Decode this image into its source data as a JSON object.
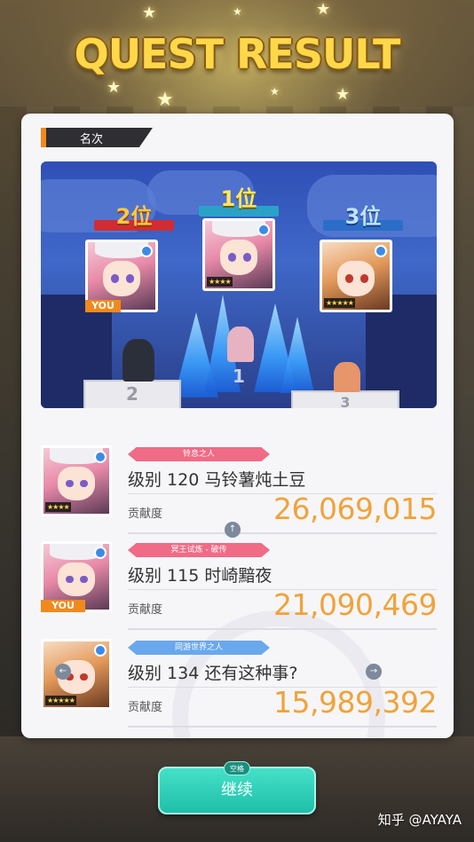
{
  "title": "QUEST RESULT",
  "section_label": "名次",
  "podium": [
    {
      "rank_label": "2位",
      "badge": "YOU",
      "stars": "★★★★★"
    },
    {
      "rank_label": "1位",
      "badge": "",
      "stars": "★★★★"
    },
    {
      "rank_label": "3位",
      "badge": "",
      "stars": "★★★★★"
    }
  ],
  "podium_steps": [
    "2",
    "1",
    "3"
  ],
  "results": [
    {
      "title_tag": "铃息之人",
      "name": "级别 120 马铃薯炖土豆",
      "contrib_label": "贡献度",
      "score": "26,069,015",
      "stars": "★★★★",
      "badge": "",
      "tag_color": "#f06b86"
    },
    {
      "title_tag": "冥王试炼 - 破传",
      "name": "级别 115 时崎黯夜",
      "contrib_label": "贡献度",
      "score": "21,090,469",
      "stars": "",
      "badge": "YOU",
      "tag_color": "#f06b86"
    },
    {
      "title_tag": "同游世界之人",
      "name": "级别 134 还有这种事?",
      "contrib_label": "贡献度",
      "score": "15,989,392",
      "stars": "★★★★★",
      "badge": "",
      "tag_color": "#6aa8ee"
    }
  ],
  "nav": {
    "prev": "↑",
    "next": "→",
    "back": "←"
  },
  "continue_button": {
    "label": "继续",
    "key_hint": "空格"
  },
  "watermark": "知乎 @AYAYA"
}
